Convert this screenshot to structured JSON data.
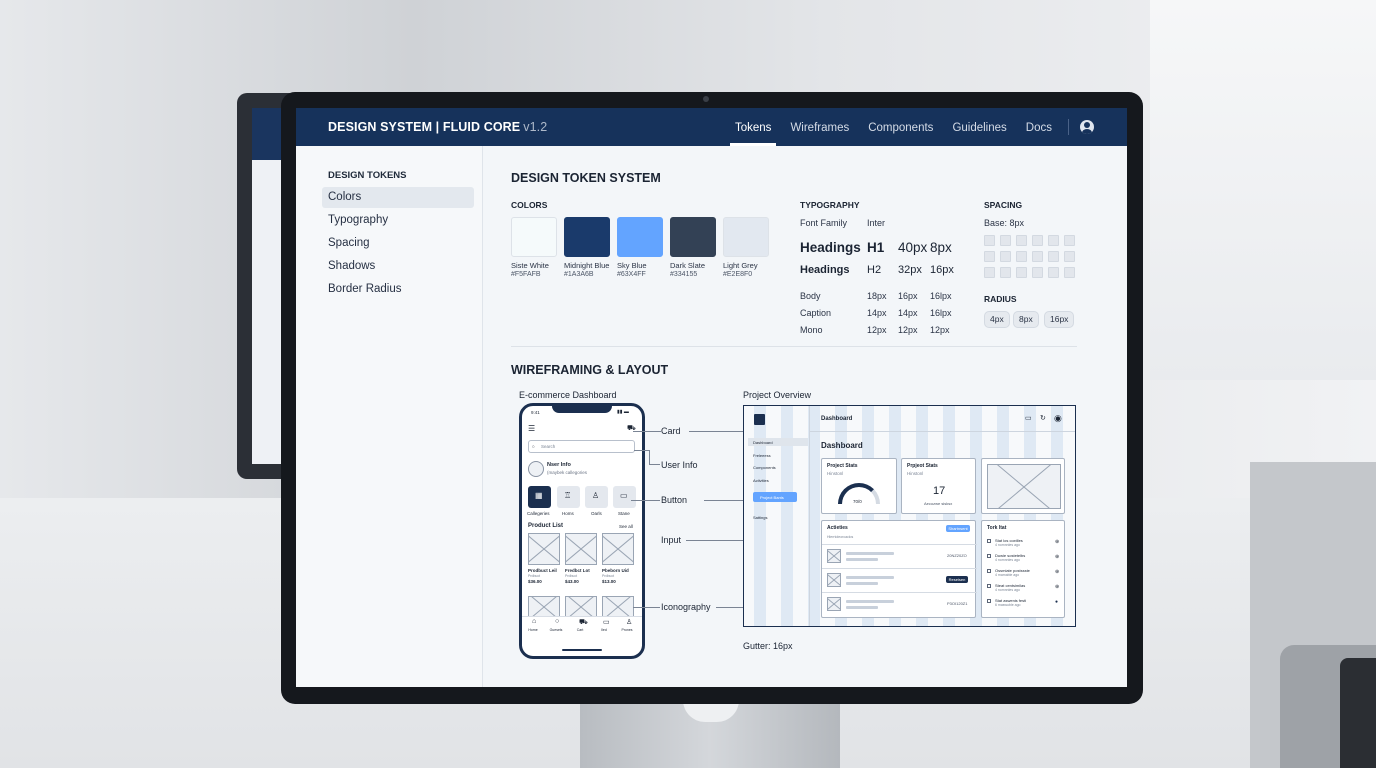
{
  "app": {
    "title": "DESIGN SYSTEM | FLUID CORE",
    "version": "v1.2"
  },
  "nav": {
    "items": [
      "Tokens",
      "Wireframes",
      "Components",
      "Guidelines",
      "Docs"
    ],
    "active": "Tokens"
  },
  "sidebar": {
    "title": "DESIGN TOKENS",
    "items": [
      "Colors",
      "Typography",
      "Spacing",
      "Shadows",
      "Border Radius"
    ],
    "active": "Colors"
  },
  "main": {
    "title": "DESIGN TOKEN SYSTEM"
  },
  "colors": {
    "title": "COLORS",
    "swatches": [
      {
        "name": "Siste White",
        "hex": "#F5FAFB",
        "color": "#F5FAFB"
      },
      {
        "name": "Midnight Blue",
        "hex": "#1A3A6B",
        "color": "#1A3A6B"
      },
      {
        "name": "Sky Blue",
        "hex": "#63X4FF",
        "color": "#63A4FF"
      },
      {
        "name": "Dark Slate",
        "hex": "#334155",
        "color": "#334155"
      },
      {
        "name": "Light Grey",
        "hex": "#E2E8F0",
        "color": "#E2E8F0"
      }
    ]
  },
  "typography": {
    "title": "TYPOGRAPHY",
    "font_family_label": "Font Family",
    "font_family": "Inter",
    "rows": [
      {
        "label": "Headings",
        "tag": "H1",
        "size": "40px",
        "spacing": "8px"
      },
      {
        "label": "Headings",
        "tag": "H2",
        "size": "32px",
        "spacing": "16px"
      },
      {
        "label": "Body",
        "tag": "18px",
        "size": "16px",
        "spacing": "16lpx"
      },
      {
        "label": "Caption",
        "tag": "14px",
        "size": "14px",
        "spacing": "16lpx"
      },
      {
        "label": "Mono",
        "tag": "12px",
        "size": "12px",
        "spacing": "12px"
      }
    ]
  },
  "spacing": {
    "title": "SPACING",
    "base": "Base: 8px"
  },
  "radius": {
    "title": "RADIUS",
    "chips": [
      "4px",
      "8px",
      "16px"
    ]
  },
  "wireframing": {
    "title": "WIREFRAMING & LAYOUT",
    "mobile_label": "E-commerce Dashboard",
    "desktop_label": "Project Overview",
    "gutter": "Gutter: 16px",
    "callouts": [
      "Card",
      "User Info",
      "Button",
      "Input",
      "Iconography"
    ]
  },
  "phone": {
    "time": "9:41",
    "search": "Search",
    "user_name": "Nser Info",
    "user_sub": "(maybek callegories",
    "categories": [
      "Callegeries",
      "Homs",
      "Oarls",
      "Stane"
    ],
    "product_list": "Product List",
    "see_all": "See all",
    "products": [
      {
        "name": "Prodbuct Leil",
        "sub": "Prdbuct",
        "price": "$36.00"
      },
      {
        "name": "Fredbct Lot",
        "sub": "Prdbuct",
        "price": "$43.00"
      },
      {
        "name": "Pbeborn Uid",
        "sub": "Prdbuct",
        "price": "$13.00"
      }
    ],
    "tabs": [
      "Home",
      "Guesels",
      "Cart",
      "Iled",
      "Prones"
    ]
  },
  "desktop": {
    "header": "Dashboard",
    "heading": "Dashboard",
    "nav": [
      "Dashboard",
      "Freleeess",
      "Components",
      "Activities"
    ],
    "nav_button": "Project Bants",
    "settings": "Sattings",
    "stats1_title": "Project Stats",
    "stats1_sub": "Hinstonl",
    "stats1_value": "70/0",
    "stats2_title": "Prpjeot Stats",
    "stats2_sub": "Hinstonl",
    "stats2_value": "17",
    "stats2_caption": "Aecozwe sisksx",
    "activities_title": "Actieties",
    "activities_sub": "Hlerrtoleorcaclos",
    "activities_button": "Shartnsent",
    "activity_values": [
      "20NZ20ZO",
      "",
      "P3OI120Z1"
    ],
    "activity_badge": "Reseisen",
    "tasks_title": "Tork ltat",
    "tasks": [
      {
        "title": "Stat los coxtlles",
        "sub": "4 nomnnles ago"
      },
      {
        "title": "Duwie sostetelbs",
        "sub": "4 nomnnles ago"
      },
      {
        "title": "Ossmiate postssste",
        "sub": "4 mamable ago"
      },
      {
        "title": "Steat centsimilas",
        "sub": "4 nomnnles ago"
      },
      {
        "title": "Stat aswenis festi",
        "sub": "6 maswuble ago"
      }
    ]
  }
}
